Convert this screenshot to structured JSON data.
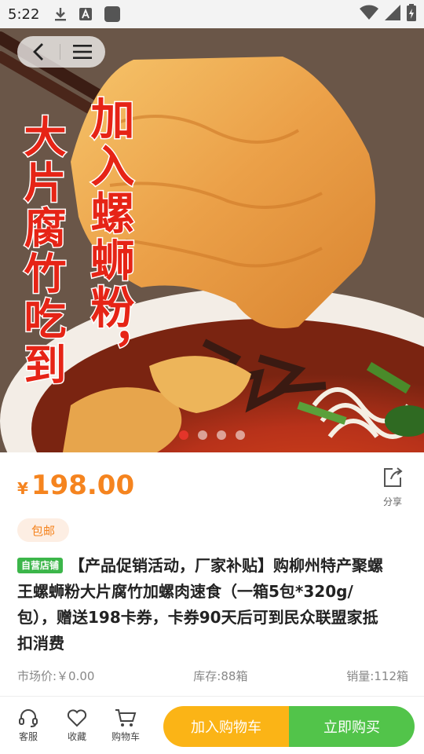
{
  "status_bar": {
    "time": "5:22",
    "icons_left": [
      "download-icon",
      "keyboard-a-icon",
      "app-square-icon"
    ],
    "icons_right": [
      "wifi-icon",
      "signal-icon",
      "battery-icon"
    ]
  },
  "hero": {
    "overlay_text_left": "大片腐竹吃到",
    "overlay_text_right": "加入螺蛳粉，",
    "carousel_count": 4,
    "carousel_active_index": 0
  },
  "product": {
    "currency_symbol": "¥",
    "price": "198.00",
    "share_label": "分享",
    "tag_free_shipping": "包邮",
    "self_store_badge": "自营店铺",
    "title": "【产品促销活动，厂家补贴】购柳州特产聚螺王螺蛳粉大片腐竹加螺肉速食（一箱5包*320g/包），赠送198卡券，卡券90天后可到民众联盟家抵扣消费",
    "market_price": "市场价:￥0.00",
    "stock": "库存:88箱",
    "sales": "销量:112箱"
  },
  "bottom_bar": {
    "service_label": "客服",
    "favorite_label": "收藏",
    "cart_label": "购物车",
    "add_to_cart_label": "加入购物车",
    "buy_now_label": "立即购买"
  },
  "colors": {
    "accent_orange": "#f5841f",
    "cart_button": "#fbb416",
    "buy_button": "#52c44a",
    "badge_green": "#3cb64a",
    "carousel_active": "#e4352a"
  }
}
